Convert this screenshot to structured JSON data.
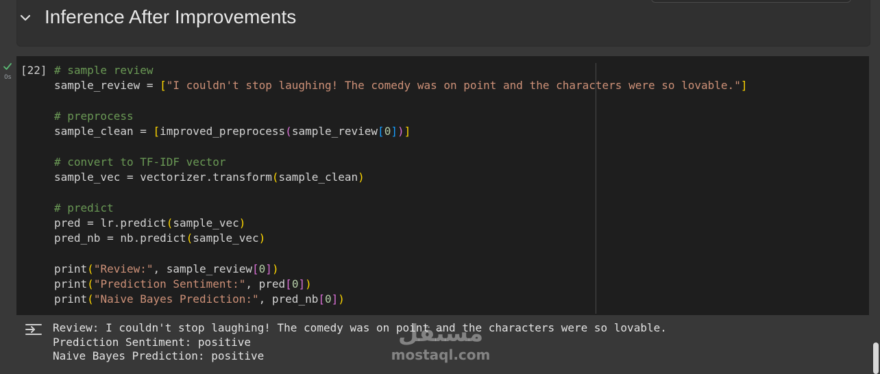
{
  "section": {
    "title": "Inference After Improvements",
    "collapse_icon": "chevron-down-icon"
  },
  "cell": {
    "execution_count": "[22]",
    "status_icon": "check-icon",
    "run_time": "0s"
  },
  "code_lines": [
    "# sample review",
    "sample_review = [\"I couldn't stop laughing! The comedy was on point and the characters were so lovable.\"]",
    "",
    "# preprocess",
    "sample_clean = [improved_preprocess(sample_review[0])]",
    "",
    "# convert to TF-IDF vector",
    "sample_vec = vectorizer.transform(sample_clean)",
    "",
    "# predict",
    "pred = lr.predict(sample_vec)",
    "pred_nb = nb.predict(sample_vec)",
    "",
    "print(\"Review:\", sample_review[0])",
    "print(\"Prediction Sentiment:\", pred[0])",
    "print(\"Naive Bayes Prediction:\", pred_nb[0])"
  ],
  "output": {
    "icon": "output-collapse-icon",
    "lines": [
      "Review: I couldn't stop laughing! The comedy was on point and the characters were so lovable.",
      "Prediction Sentiment: positive",
      "Naive Bayes Prediction: positive"
    ]
  },
  "watermark": {
    "arabic": "مستقل",
    "latin": "mostaql.com"
  },
  "colors": {
    "background": "#383838",
    "code_background": "#1e1e1e",
    "comment": "#6a9955",
    "string": "#ce9178",
    "number": "#b5cea8",
    "function": "#dcdcaa",
    "bracket_level1": "#ffd700",
    "bracket_level2": "#da70d6",
    "bracket_level3": "#179fff",
    "success_check": "#5bb974"
  }
}
